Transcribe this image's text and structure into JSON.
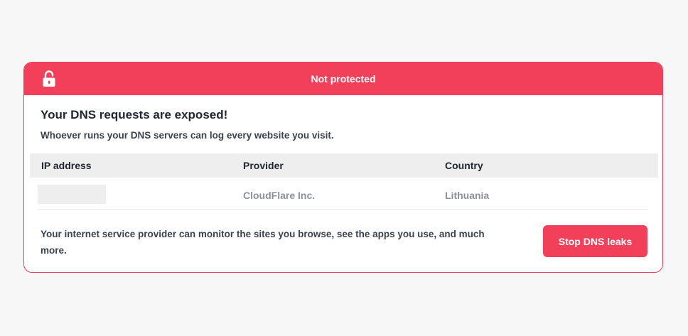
{
  "banner": {
    "title": "Not protected",
    "icon": "unlocked-padlock-icon",
    "color": "#f2405a"
  },
  "main": {
    "headline": "Your DNS requests are exposed!",
    "subline": "Whoever runs your DNS servers can log every website you visit."
  },
  "table": {
    "columns": [
      "IP address",
      "Provider",
      "Country"
    ],
    "rows": [
      {
        "ip": "",
        "provider": "CloudFlare Inc.",
        "country": "Lithuania"
      }
    ]
  },
  "footer": {
    "text": "Your internet service provider can monitor the sites you browse, see the apps you use, and much more.",
    "button_label": "Stop DNS leaks"
  }
}
